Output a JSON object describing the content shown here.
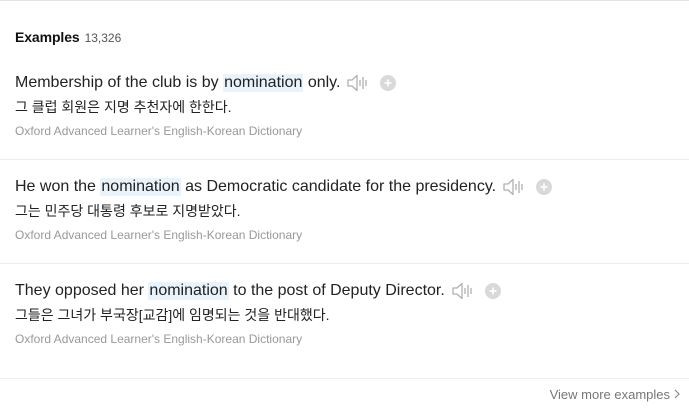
{
  "header": {
    "title": "Examples",
    "count": "13,326"
  },
  "examples": [
    {
      "before": "Membership of the club is by ",
      "keyword": "nomination",
      "after": " only.",
      "translation": "그 클럽 회원은 지명 추천자에 한한다.",
      "source": "Oxford Advanced Learner's English-Korean Dictionary"
    },
    {
      "before": "He won the ",
      "keyword": "nomination",
      "after": " as Democratic candidate for the presidency.",
      "translation": "그는 민주당 대통령 후보로 지명받았다.",
      "source": "Oxford Advanced Learner's English-Korean Dictionary"
    },
    {
      "before": "They opposed her ",
      "keyword": "nomination",
      "after": " to the post of Deputy Director.",
      "translation": "그들은 그녀가 부국장[교감]에 임명되는 것을 반대했다.",
      "source": "Oxford Advanced Learner's English-Korean Dictionary"
    }
  ],
  "footer": {
    "view_more_label": "View more examples"
  },
  "icons": {
    "speaker": "speaker-icon",
    "add": "plus-icon",
    "chevron": "chevron-right-icon"
  },
  "colors": {
    "highlight": "#e8f3fc",
    "icon_gray": "#b0b0b0",
    "source_text": "#999999"
  }
}
